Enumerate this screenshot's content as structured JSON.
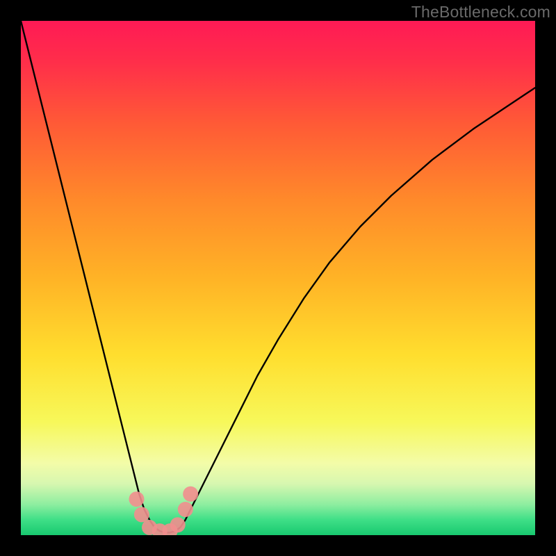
{
  "watermark": "TheBottleneck.com",
  "chart_data": {
    "type": "line",
    "title": "",
    "xlabel": "",
    "ylabel": "",
    "xlim": [
      0,
      100
    ],
    "ylim": [
      0,
      100
    ],
    "background_gradient": {
      "stops": [
        {
          "offset": 0.0,
          "color": "#ff1a55"
        },
        {
          "offset": 0.08,
          "color": "#ff2e4a"
        },
        {
          "offset": 0.2,
          "color": "#ff5a36"
        },
        {
          "offset": 0.35,
          "color": "#ff8a2a"
        },
        {
          "offset": 0.5,
          "color": "#ffb326"
        },
        {
          "offset": 0.65,
          "color": "#ffde2e"
        },
        {
          "offset": 0.78,
          "color": "#f7f85a"
        },
        {
          "offset": 0.86,
          "color": "#f3fca8"
        },
        {
          "offset": 0.9,
          "color": "#d7f7b0"
        },
        {
          "offset": 0.94,
          "color": "#8eeea0"
        },
        {
          "offset": 0.97,
          "color": "#3fdf87"
        },
        {
          "offset": 1.0,
          "color": "#18c86f"
        }
      ]
    },
    "series": [
      {
        "name": "bottleneck-curve",
        "stroke": "#000000",
        "x": [
          0,
          2,
          4,
          6,
          8,
          10,
          12,
          14,
          16,
          18,
          20,
          22,
          23,
          24,
          25,
          26,
          27,
          28,
          29,
          30,
          31,
          32,
          33,
          35,
          38,
          42,
          46,
          50,
          55,
          60,
          66,
          72,
          80,
          88,
          100
        ],
        "y": [
          100,
          92,
          84,
          76,
          68,
          60,
          52,
          44,
          36,
          28,
          20,
          12,
          8,
          5,
          3,
          1.5,
          0.8,
          0.5,
          0.5,
          0.8,
          1.5,
          3,
          5,
          9,
          15,
          23,
          31,
          38,
          46,
          53,
          60,
          66,
          73,
          79,
          87
        ]
      }
    ],
    "markers": {
      "color": "#f28e8e",
      "opacity": 0.9,
      "points": [
        {
          "x": 22.5,
          "y": 7
        },
        {
          "x": 23.5,
          "y": 4
        },
        {
          "x": 25.0,
          "y": 1.5
        },
        {
          "x": 27.0,
          "y": 0.8
        },
        {
          "x": 29.0,
          "y": 0.8
        },
        {
          "x": 30.5,
          "y": 2
        },
        {
          "x": 32.0,
          "y": 5
        },
        {
          "x": 33.0,
          "y": 8
        }
      ]
    }
  }
}
